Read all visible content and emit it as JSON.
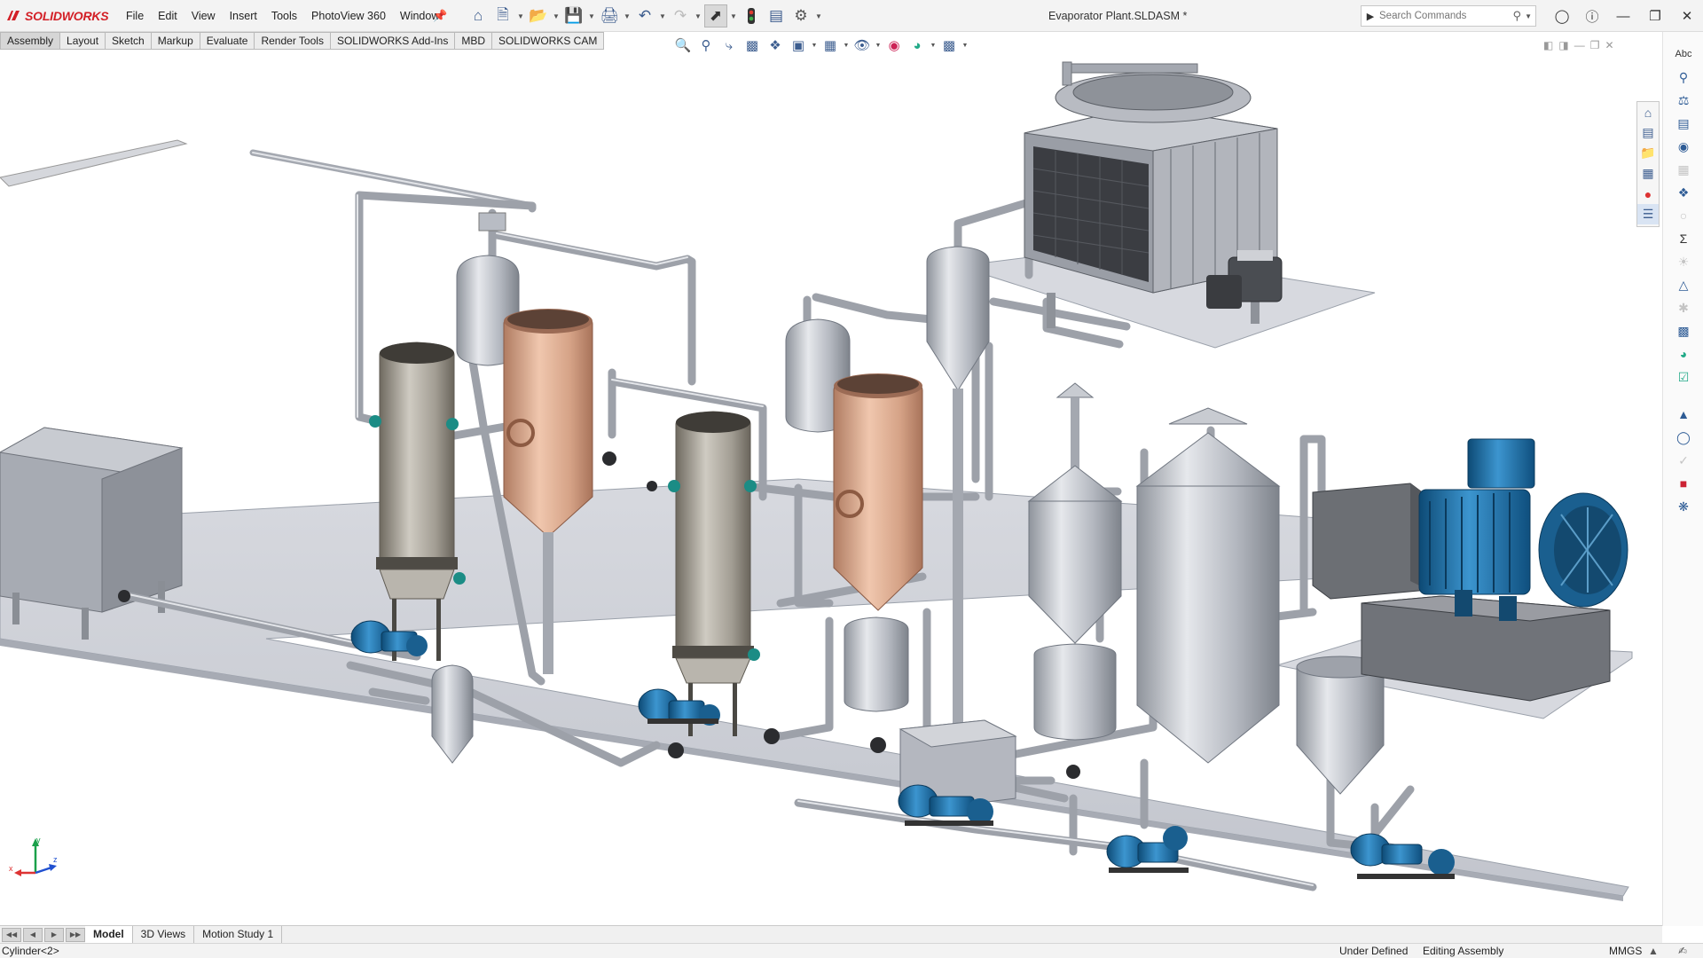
{
  "app": {
    "brand": "SOLIDWORKS",
    "document_title": "Evaporator Plant.SLDASM *"
  },
  "menu": {
    "items": [
      "File",
      "Edit",
      "View",
      "Insert",
      "Tools",
      "PhotoView 360",
      "Window"
    ]
  },
  "quick_access": {
    "icons": [
      "home-icon",
      "new-document-icon",
      "open-icon",
      "save-icon",
      "print-icon",
      "undo-icon",
      "redo-icon",
      "select-icon",
      "rebuild-icon",
      "file-properties-icon",
      "options-icon"
    ]
  },
  "search": {
    "placeholder": "Search Commands"
  },
  "command_tabs": [
    "Assembly",
    "Layout",
    "Sketch",
    "Markup",
    "Evaluate",
    "Render Tools",
    "SOLIDWORKS Add-Ins",
    "MBD",
    "SOLIDWORKS CAM"
  ],
  "active_command_tab": "Assembly",
  "heads_up_toolbar": {
    "icons": [
      "zoom-to-fit-icon",
      "zoom-to-area-icon",
      "previous-view-icon",
      "section-view-icon",
      "dynamic-annotation-icon",
      "view-orientation-icon",
      "display-style-icon",
      "hide-show-icon",
      "edit-appearance-icon",
      "apply-scene-icon",
      "view-settings-icon"
    ]
  },
  "bottom_tabs": [
    "Model",
    "3D Views",
    "Motion Study 1"
  ],
  "active_bottom_tab": "Model",
  "status": {
    "selection": "Cylinder<2>",
    "definition": "Under Defined",
    "mode": "Editing Assembly",
    "units": "MMGS"
  },
  "triad": {
    "x_label": "x",
    "y_label": "y",
    "z_label": "z"
  },
  "colors": {
    "brand": "#d31f26",
    "steel": "#b8bcc4",
    "copper": "#d7a78a",
    "motor_blue": "#1b6fa8",
    "floor": "#c9ccd4"
  }
}
